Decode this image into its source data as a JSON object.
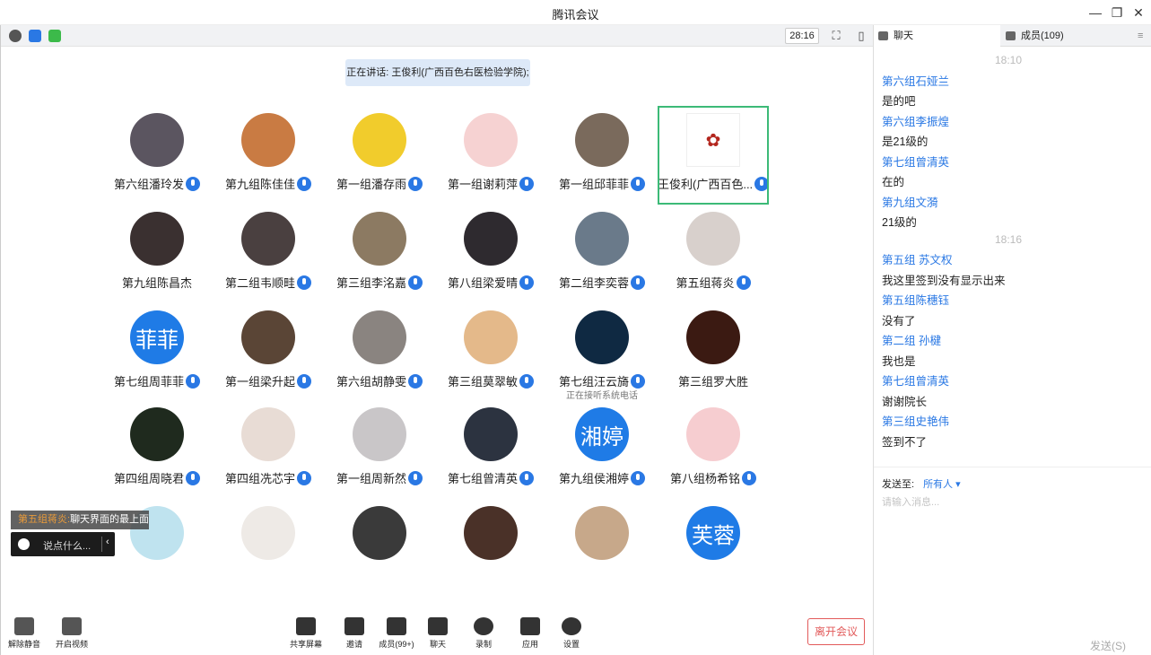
{
  "window": {
    "title": "腾讯会议",
    "minimize": "—",
    "restore": "❐",
    "close": "✕"
  },
  "top_toolbar": {
    "timer": "28:16"
  },
  "speaking": "正在讲话: 王俊利(广西百色右医检验学院);",
  "participants": [
    {
      "name": "第六组潘玲发",
      "mic": true,
      "avatar": "photo",
      "color": "#5b5560"
    },
    {
      "name": "第九组陈佳佳",
      "mic": true,
      "avatar": "photo",
      "color": "#c97b43"
    },
    {
      "name": "第一组潘存雨",
      "mic": true,
      "avatar": "photo",
      "color": "#f1cc2c"
    },
    {
      "name": "第一组谢莉萍",
      "mic": true,
      "avatar": "photo",
      "color": "#f6d2d2"
    },
    {
      "name": "第一组邱菲菲",
      "mic": true,
      "avatar": "photo",
      "color": "#7a6a5c"
    },
    {
      "name": "王俊利(广西百色...",
      "mic": true,
      "avatar": "logo",
      "color": "#ffffff",
      "highlight": true
    },
    {
      "name": "第九组陈昌杰",
      "mic": false,
      "avatar": "photo",
      "color": "#3a3030"
    },
    {
      "name": "第二组韦顺畦",
      "mic": true,
      "avatar": "photo",
      "color": "#4a4040"
    },
    {
      "name": "第三组李洺嘉",
      "mic": true,
      "avatar": "photo",
      "color": "#8c7a62"
    },
    {
      "name": "第八组梁爱晴",
      "mic": true,
      "avatar": "photo",
      "color": "#2e2a2f"
    },
    {
      "name": "第二组李奕蓉",
      "mic": true,
      "avatar": "photo",
      "color": "#6a7a8a"
    },
    {
      "name": "第五组蒋炎",
      "mic": true,
      "avatar": "photo",
      "color": "#d8d0cc"
    },
    {
      "name": "第七组周菲菲",
      "mic": true,
      "avatar": "text",
      "text": "菲菲",
      "color": "#1f7be6"
    },
    {
      "name": "第一组梁升起",
      "mic": true,
      "avatar": "photo",
      "color": "#5a4536"
    },
    {
      "name": "第六组胡静雯",
      "mic": true,
      "avatar": "photo",
      "color": "#8a8480"
    },
    {
      "name": "第三组莫翠敏",
      "mic": true,
      "avatar": "photo",
      "color": "#e4b98a"
    },
    {
      "name": "第七组汪云旖",
      "mic": true,
      "avatar": "photo",
      "color": "#0f2942",
      "sub": "正在接听系统电话"
    },
    {
      "name": "第三组罗大胜",
      "mic": false,
      "avatar": "photo",
      "color": "#3b1a12"
    },
    {
      "name": "第四组周晓君",
      "mic": true,
      "avatar": "photo",
      "color": "#1f2a1e"
    },
    {
      "name": "第四组冼芯宇",
      "mic": true,
      "avatar": "photo",
      "color": "#e8dcd5"
    },
    {
      "name": "第一组周新然",
      "mic": true,
      "avatar": "photo",
      "color": "#c9c6c8"
    },
    {
      "name": "第七组曾清英",
      "mic": true,
      "avatar": "photo",
      "color": "#2c3340"
    },
    {
      "name": "第九组侯湘婷",
      "mic": true,
      "avatar": "text",
      "text": "湘婷",
      "color": "#1f7be6"
    },
    {
      "name": "第八组杨希铭",
      "mic": true,
      "avatar": "photo",
      "color": "#f6cdd0"
    },
    {
      "name": "",
      "mic": false,
      "avatar": "photo",
      "color": "#bfe3ef"
    },
    {
      "name": "",
      "mic": false,
      "avatar": "photo",
      "color": "#eeeae6"
    },
    {
      "name": "",
      "mic": false,
      "avatar": "photo",
      "color": "#3a3a3a"
    },
    {
      "name": "",
      "mic": false,
      "avatar": "photo",
      "color": "#4a3128"
    },
    {
      "name": "",
      "mic": false,
      "avatar": "photo",
      "color": "#c7a88a"
    },
    {
      "name": "",
      "mic": false,
      "avatar": "text",
      "text": "芙蓉",
      "color": "#1f7be6"
    }
  ],
  "notice": {
    "who": "第五组蒋炎:",
    "text": "聊天界面的最上面"
  },
  "saybox": {
    "placeholder": "说点什么..."
  },
  "bottom": {
    "unmute": "解除静音",
    "video": "开启视频",
    "share": "共享屏幕",
    "invite": "邀请",
    "members": "成员(99+)",
    "chat": "聊天",
    "record": "录制",
    "apps": "应用",
    "settings": "设置",
    "leave": "离开会议"
  },
  "side": {
    "tab_chat": "聊天",
    "tab_members": "成员(109)",
    "messages": [
      {
        "type": "time",
        "text": "18:10"
      },
      {
        "type": "name",
        "text": "第六组石娅兰"
      },
      {
        "type": "text",
        "text": "是的吧"
      },
      {
        "type": "name",
        "text": "第六组李振煌"
      },
      {
        "type": "text",
        "text": "是21级的"
      },
      {
        "type": "name",
        "text": "第七组曾清英"
      },
      {
        "type": "text",
        "text": "在的"
      },
      {
        "type": "name",
        "text": "第九组文漪"
      },
      {
        "type": "text",
        "text": "21级的"
      },
      {
        "type": "time",
        "text": "18:16"
      },
      {
        "type": "name",
        "text": "第五组 苏文权"
      },
      {
        "type": "text",
        "text": "我这里签到没有显示出来"
      },
      {
        "type": "name",
        "text": "第五组陈穗钰"
      },
      {
        "type": "text",
        "text": "没有了"
      },
      {
        "type": "name",
        "text": "第二组 孙楗"
      },
      {
        "type": "text",
        "text": "我也是"
      },
      {
        "type": "name",
        "text": "第七组曾清英"
      },
      {
        "type": "text",
        "text": "谢谢院长"
      },
      {
        "type": "name",
        "text": "第三组史艳伟"
      },
      {
        "type": "text",
        "text": "签到不了"
      }
    ],
    "send_to_label": "发送至:",
    "send_to_value": "所有人 ▾",
    "input_placeholder": "请输入消息...",
    "send": "发送(S)"
  }
}
